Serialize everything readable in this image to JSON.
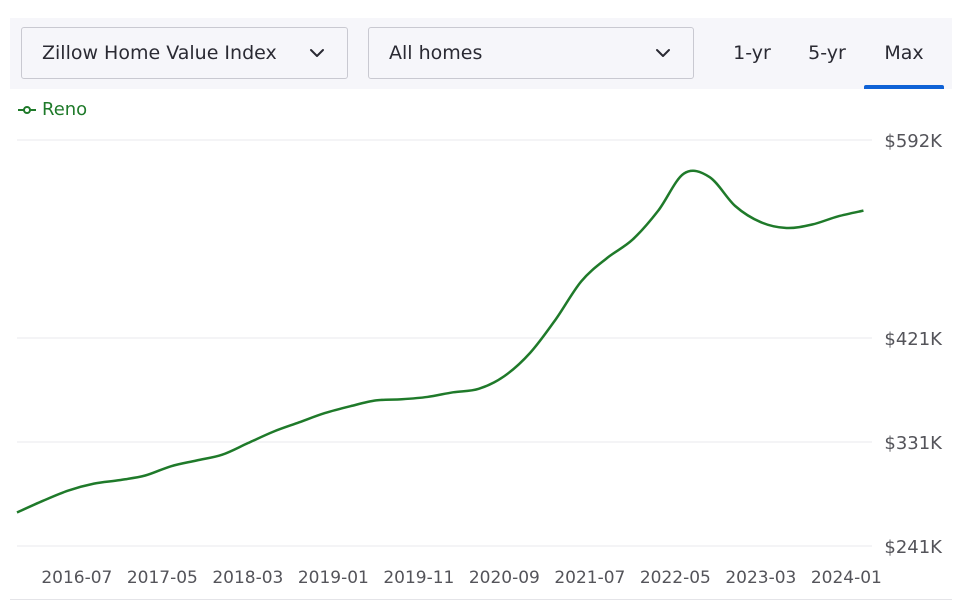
{
  "toolbar": {
    "metric_dropdown": {
      "label": "Zillow Home Value Index",
      "icon": "chevron-down-icon"
    },
    "type_dropdown": {
      "label": "All homes",
      "icon": "chevron-down-icon"
    },
    "tabs": [
      {
        "label": "1-yr",
        "selected": false
      },
      {
        "label": "5-yr",
        "selected": false
      },
      {
        "label": "Max",
        "selected": true
      }
    ],
    "accent_color": "#0f62d6"
  },
  "chart_data": {
    "type": "line",
    "title": "",
    "xlabel": "",
    "ylabel": "",
    "legend": {
      "placement": "top-left",
      "entries": [
        "Reno"
      ]
    },
    "grid": true,
    "x_range": [
      "2015-12",
      "2024-04"
    ],
    "ylim": [
      241000,
      592000
    ],
    "y_ticks": [
      {
        "value": 241000,
        "label": "$241K"
      },
      {
        "value": 331000,
        "label": "$331K"
      },
      {
        "value": 421000,
        "label": "$421K"
      },
      {
        "value": 592000,
        "label": "$592K"
      }
    ],
    "x_ticks": [
      "2016-07",
      "2017-05",
      "2018-03",
      "2019-01",
      "2019-11",
      "2020-09",
      "2021-07",
      "2022-05",
      "2023-03",
      "2024-01"
    ],
    "series": [
      {
        "name": "Reno",
        "color": "#1f7a2a",
        "points": [
          [
            "2015-12",
            270000
          ],
          [
            "2016-03",
            280000
          ],
          [
            "2016-06",
            289000
          ],
          [
            "2016-09",
            295000
          ],
          [
            "2016-12",
            298000
          ],
          [
            "2017-03",
            302000
          ],
          [
            "2017-06",
            310000
          ],
          [
            "2017-09",
            315000
          ],
          [
            "2017-12",
            320000
          ],
          [
            "2018-03",
            330000
          ],
          [
            "2018-06",
            340000
          ],
          [
            "2018-09",
            348000
          ],
          [
            "2018-12",
            356000
          ],
          [
            "2019-03",
            362000
          ],
          [
            "2019-06",
            367000
          ],
          [
            "2019-09",
            368000
          ],
          [
            "2019-12",
            370000
          ],
          [
            "2020-03",
            374000
          ],
          [
            "2020-06",
            377000
          ],
          [
            "2020-09",
            388000
          ],
          [
            "2020-12",
            408000
          ],
          [
            "2021-03",
            437000
          ],
          [
            "2021-06",
            470000
          ],
          [
            "2021-09",
            490000
          ],
          [
            "2021-12",
            506000
          ],
          [
            "2022-03",
            531000
          ],
          [
            "2022-06",
            563000
          ],
          [
            "2022-09",
            560000
          ],
          [
            "2022-12",
            535000
          ],
          [
            "2023-03",
            521000
          ],
          [
            "2023-06",
            516000
          ],
          [
            "2023-09",
            519000
          ],
          [
            "2023-12",
            526000
          ],
          [
            "2024-03",
            531000
          ]
        ]
      }
    ]
  }
}
